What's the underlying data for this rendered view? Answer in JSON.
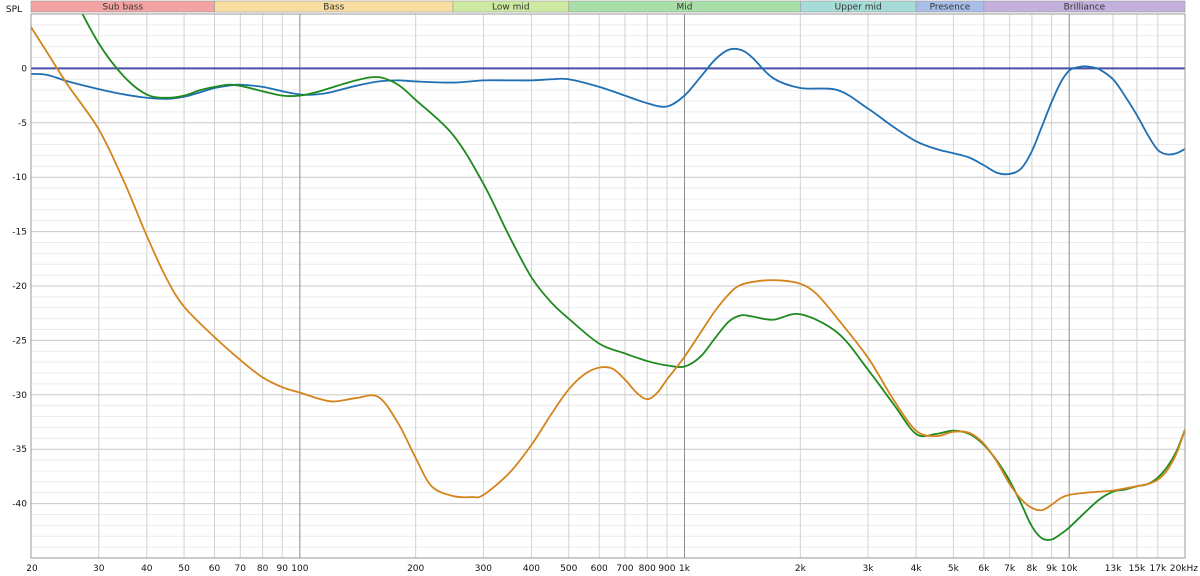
{
  "chart_data": {
    "type": "line",
    "ylabel": "SPL",
    "x_scale": "log",
    "xlim": [
      20,
      20000
    ],
    "ylim": [
      -45,
      5
    ],
    "grid": true,
    "legend": "none",
    "x_ticks": [
      {
        "value": 20,
        "label": "20"
      },
      {
        "value": 30,
        "label": "30"
      },
      {
        "value": 40,
        "label": "40"
      },
      {
        "value": 50,
        "label": "50"
      },
      {
        "value": 60,
        "label": "60"
      },
      {
        "value": 70,
        "label": "70"
      },
      {
        "value": 80,
        "label": "80"
      },
      {
        "value": 90,
        "label": "90"
      },
      {
        "value": 100,
        "label": "100"
      },
      {
        "value": 200,
        "label": "200"
      },
      {
        "value": 300,
        "label": "300"
      },
      {
        "value": 400,
        "label": "400"
      },
      {
        "value": 500,
        "label": "500"
      },
      {
        "value": 600,
        "label": "600"
      },
      {
        "value": 700,
        "label": "700"
      },
      {
        "value": 800,
        "label": "800"
      },
      {
        "value": 900,
        "label": "900"
      },
      {
        "value": 1000,
        "label": "1k"
      },
      {
        "value": 2000,
        "label": "2k"
      },
      {
        "value": 3000,
        "label": "3k"
      },
      {
        "value": 4000,
        "label": "4k"
      },
      {
        "value": 5000,
        "label": "5k"
      },
      {
        "value": 6000,
        "label": "6k"
      },
      {
        "value": 7000,
        "label": "7k"
      },
      {
        "value": 8000,
        "label": "8k"
      },
      {
        "value": 9000,
        "label": "9k"
      },
      {
        "value": 10000,
        "label": "10k"
      },
      {
        "value": 13000,
        "label": "13k"
      },
      {
        "value": 15000,
        "label": "15k"
      },
      {
        "value": 17000,
        "label": "17k"
      },
      {
        "value": 20000,
        "label": "20kHz"
      }
    ],
    "major_x": [
      100,
      1000,
      10000
    ],
    "y_ticks": [
      0,
      -5,
      -10,
      -15,
      -20,
      -25,
      -30,
      -35,
      -40
    ],
    "reference_line": 0,
    "bands": [
      {
        "label": "Sub bass",
        "from": 20,
        "to": 60,
        "color": "#f4a3a3"
      },
      {
        "label": "Bass",
        "from": 60,
        "to": 250,
        "color": "#f8dea0"
      },
      {
        "label": "Low mid",
        "from": 250,
        "to": 500,
        "color": "#cdeaa0"
      },
      {
        "label": "Mid",
        "from": 500,
        "to": 2000,
        "color": "#a8dfa8"
      },
      {
        "label": "Upper mid",
        "from": 2000,
        "to": 4000,
        "color": "#a6dcd8"
      },
      {
        "label": "Presence",
        "from": 4000,
        "to": 6000,
        "color": "#a8bde8"
      },
      {
        "label": "Brilliance",
        "from": 6000,
        "to": 20000,
        "color": "#c4b0dc"
      }
    ],
    "series": [
      {
        "color": "#1f6fb4",
        "x": [
          20,
          22,
          25,
          30,
          35,
          40,
          45,
          50,
          55,
          60,
          65,
          70,
          80,
          90,
          100,
          110,
          120,
          140,
          160,
          180,
          200,
          250,
          300,
          350,
          400,
          450,
          500,
          600,
          700,
          800,
          900,
          1000,
          1100,
          1200,
          1300,
          1400,
          1500,
          1700,
          2000,
          2500,
          3000,
          3500,
          4000,
          4500,
          5000,
          5500,
          6000,
          6500,
          7000,
          7500,
          8000,
          8500,
          9000,
          9500,
          10000,
          10500,
          11000,
          11500,
          12000,
          13000,
          14000,
          15000,
          16000,
          17000,
          18000,
          19000,
          20000
        ],
        "y": [
          -0.5,
          -0.6,
          -1.2,
          -1.9,
          -2.4,
          -2.7,
          -2.8,
          -2.6,
          -2.2,
          -1.8,
          -1.6,
          -1.5,
          -1.7,
          -2.1,
          -2.4,
          -2.4,
          -2.2,
          -1.6,
          -1.2,
          -1.1,
          -1.2,
          -1.3,
          -1.1,
          -1.1,
          -1.1,
          -1.0,
          -1.0,
          -1.7,
          -2.5,
          -3.2,
          -3.5,
          -2.5,
          -0.8,
          0.8,
          1.7,
          1.7,
          1.0,
          -0.9,
          -1.8,
          -2.0,
          -3.7,
          -5.4,
          -6.7,
          -7.4,
          -7.8,
          -8.2,
          -8.9,
          -9.6,
          -9.7,
          -9.2,
          -7.6,
          -5.3,
          -3.1,
          -1.3,
          -0.2,
          0.1,
          0.2,
          0.1,
          -0.1,
          -1.0,
          -2.6,
          -4.3,
          -6.1,
          -7.5,
          -7.9,
          -7.8,
          -7.4
        ]
      },
      {
        "color": "#1e8a1e",
        "x": [
          20,
          25,
          30,
          35,
          40,
          45,
          50,
          55,
          60,
          65,
          70,
          80,
          90,
          100,
          110,
          120,
          140,
          160,
          180,
          200,
          250,
          300,
          350,
          400,
          450,
          500,
          600,
          700,
          800,
          900,
          1000,
          1100,
          1200,
          1300,
          1400,
          1500,
          1700,
          2000,
          2500,
          3000,
          3500,
          4000,
          4500,
          5000,
          5500,
          6000,
          6500,
          7000,
          7500,
          8000,
          8500,
          9000,
          9500,
          10000,
          11000,
          12000,
          13000,
          14000,
          15000,
          16000,
          17000,
          18000,
          19000,
          20000
        ],
        "y": [
          14,
          7.5,
          2.3,
          -0.8,
          -2.4,
          -2.7,
          -2.5,
          -2.0,
          -1.7,
          -1.5,
          -1.6,
          -2.1,
          -2.5,
          -2.5,
          -2.2,
          -1.8,
          -1.1,
          -0.8,
          -1.5,
          -2.9,
          -6.1,
          -10.6,
          -15.4,
          -19.2,
          -21.5,
          -23.0,
          -25.3,
          -26.2,
          -26.9,
          -27.3,
          -27.4,
          -26.5,
          -24.8,
          -23.3,
          -22.7,
          -22.8,
          -23.1,
          -22.6,
          -24.3,
          -27.7,
          -30.9,
          -33.6,
          -33.6,
          -33.3,
          -33.6,
          -34.6,
          -36.1,
          -37.9,
          -40.0,
          -42.1,
          -43.2,
          -43.3,
          -42.8,
          -42.2,
          -40.8,
          -39.6,
          -38.9,
          -38.7,
          -38.4,
          -38.2,
          -37.6,
          -36.6,
          -35.2,
          -33.2
        ]
      },
      {
        "color": "#d4841a",
        "x": [
          20,
          22,
          25,
          30,
          35,
          40,
          45,
          50,
          60,
          70,
          80,
          90,
          100,
          120,
          140,
          160,
          180,
          200,
          220,
          250,
          280,
          300,
          350,
          400,
          450,
          500,
          550,
          600,
          650,
          700,
          750,
          800,
          850,
          900,
          1000,
          1100,
          1200,
          1300,
          1400,
          1600,
          1800,
          2000,
          2200,
          2500,
          3000,
          3500,
          4000,
          4500,
          5000,
          5500,
          6000,
          6500,
          7000,
          7500,
          8000,
          8500,
          9000,
          9500,
          10000,
          11000,
          12000,
          13000,
          14000,
          15000,
          16000,
          17000,
          18000,
          19000,
          20000
        ],
        "y": [
          3.8,
          1.5,
          -1.6,
          -5.6,
          -10.5,
          -15.4,
          -19.3,
          -21.9,
          -24.7,
          -26.8,
          -28.4,
          -29.3,
          -29.8,
          -30.6,
          -30.3,
          -30.2,
          -32.6,
          -35.8,
          -38.4,
          -39.3,
          -39.4,
          -39.2,
          -37.2,
          -34.6,
          -31.8,
          -29.5,
          -28.1,
          -27.5,
          -27.6,
          -28.6,
          -29.8,
          -30.4,
          -29.8,
          -28.6,
          -26.5,
          -24.3,
          -22.3,
          -20.8,
          -19.9,
          -19.5,
          -19.5,
          -19.8,
          -20.7,
          -23.0,
          -26.6,
          -30.5,
          -33.3,
          -33.8,
          -33.4,
          -33.5,
          -34.5,
          -36.2,
          -38.2,
          -39.6,
          -40.4,
          -40.6,
          -40.1,
          -39.5,
          -39.2,
          -39.0,
          -38.9,
          -38.8,
          -38.6,
          -38.4,
          -38.2,
          -37.8,
          -36.9,
          -35.4,
          -33.2
        ]
      }
    ]
  }
}
